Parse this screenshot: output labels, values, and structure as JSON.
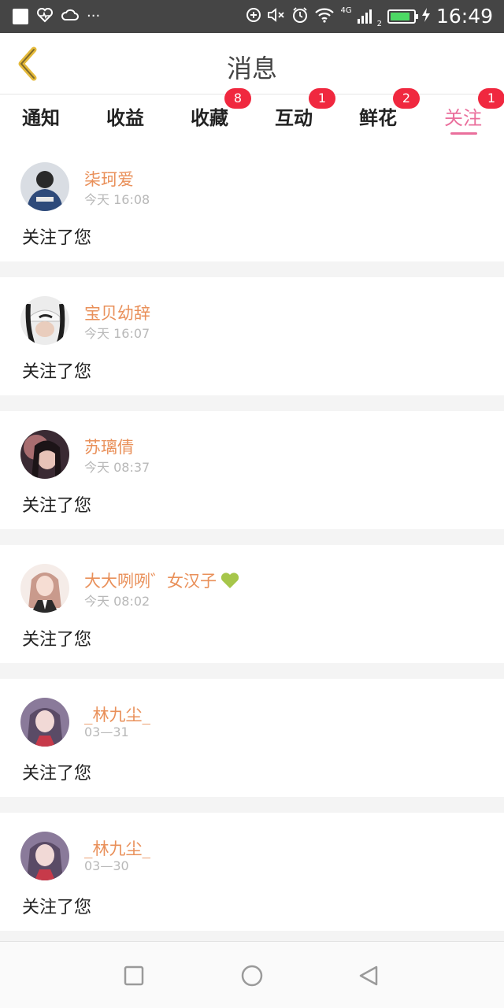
{
  "status_bar": {
    "time": "16:49",
    "network": "4G",
    "sim_slot": "2",
    "battery_level": 0.85,
    "battery_color": "#4cd964",
    "left_icons": [
      "notification-square-icon",
      "heart-pulse-icon",
      "cloud-icon",
      "more-dots-icon"
    ],
    "right_icons": [
      "data-saver-icon",
      "mute-icon",
      "alarm-icon",
      "wifi-icon",
      "signal-icon",
      "battery-icon",
      "charging-icon"
    ]
  },
  "header": {
    "title": "消息",
    "back_icon": "chevron-left-icon",
    "back_color": "#e4b93a"
  },
  "tabs": [
    {
      "label": "通知",
      "badge": null,
      "active": false
    },
    {
      "label": "收益",
      "badge": null,
      "active": false
    },
    {
      "label": "收藏",
      "badge": "8",
      "active": false
    },
    {
      "label": "互动",
      "badge": "1",
      "active": false
    },
    {
      "label": "鲜花",
      "badge": "2",
      "active": false
    },
    {
      "label": "关注",
      "badge": "1",
      "active": true
    }
  ],
  "colors": {
    "accent": "#ea6f9c",
    "badge": "#f0283f",
    "name": "#e9905a",
    "heart": "#a6c64a"
  },
  "feed": [
    {
      "name": "柒珂爱",
      "time": "今天 16:08",
      "action": "关注了您",
      "has_heart": false
    },
    {
      "name": "宝贝幼辞",
      "time": "今天 16:07",
      "action": "关注了您",
      "has_heart": false
    },
    {
      "name": "苏璃倩",
      "time": "今天 08:37",
      "action": "关注了您",
      "has_heart": false
    },
    {
      "name": "大大咧咧゛女汉子",
      "time": "今天 08:02",
      "action": "关注了您",
      "has_heart": true
    },
    {
      "name": "_林九尘_",
      "time": "03—31",
      "action": "关注了您",
      "has_heart": false
    },
    {
      "name": "_林九尘_",
      "time": "03—30",
      "action": "关注了您",
      "has_heart": false
    }
  ],
  "nav_bar": [
    "recent-apps-square-icon",
    "home-circle-icon",
    "back-triangle-icon"
  ]
}
